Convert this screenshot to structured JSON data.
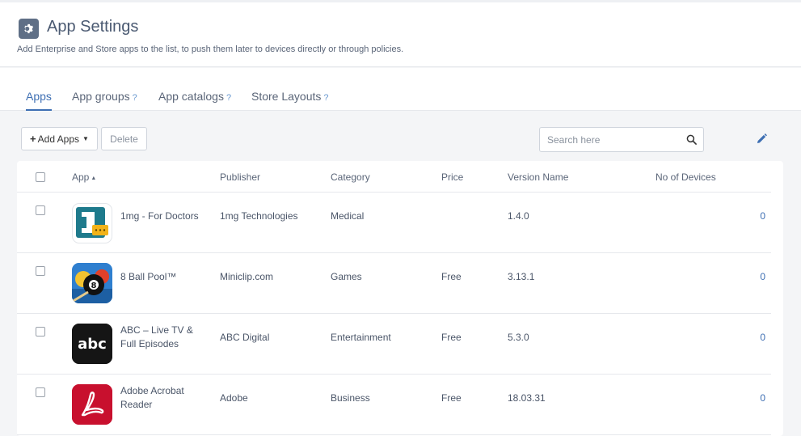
{
  "header": {
    "title": "App Settings",
    "subtitle": "Add Enterprise and Store apps to the list, to push them later to devices directly or through policies.",
    "icon": "gear-icon"
  },
  "tabs": [
    {
      "label": "Apps",
      "help": ""
    },
    {
      "label": "App groups",
      "help": "?"
    },
    {
      "label": "App catalogs",
      "help": "?"
    },
    {
      "label": "Store Layouts",
      "help": "?"
    }
  ],
  "toolbar": {
    "add_label": "Add Apps",
    "delete_label": "Delete",
    "search_placeholder": "Search here"
  },
  "table": {
    "columns": [
      "App",
      "Publisher",
      "Category",
      "Price",
      "Version Name",
      "No of Devices"
    ],
    "rows": [
      {
        "name": "1mg - For Doctors",
        "name2": "",
        "publisher": "1mg Technologies",
        "category": "Medical",
        "price": "",
        "version": "1.4.0",
        "devices": "0",
        "icon": "1mg-app-icon"
      },
      {
        "name": "8 Ball Pool™",
        "name2": "",
        "publisher": "Miniclip.com",
        "category": "Games",
        "price": "Free",
        "version": "3.13.1",
        "devices": "0",
        "icon": "8-ball-pool-app-icon"
      },
      {
        "name": "ABC – Live TV &",
        "name2": "Full Episodes",
        "publisher": "ABC Digital",
        "category": "Entertainment",
        "price": "Free",
        "version": "5.3.0",
        "devices": "0",
        "icon": "abc-app-icon"
      },
      {
        "name": "Adobe Acrobat",
        "name2": "Reader",
        "publisher": "Adobe",
        "category": "Business",
        "price": "Free",
        "version": "18.03.31",
        "devices": "0",
        "icon": "adobe-acrobat-app-icon"
      }
    ]
  },
  "colors": {
    "accent": "#3e6fb3",
    "title_icon_bg": "#5f6f86",
    "abc_icon": "#1a1a1a",
    "adobe_icon": "#c8102e"
  }
}
